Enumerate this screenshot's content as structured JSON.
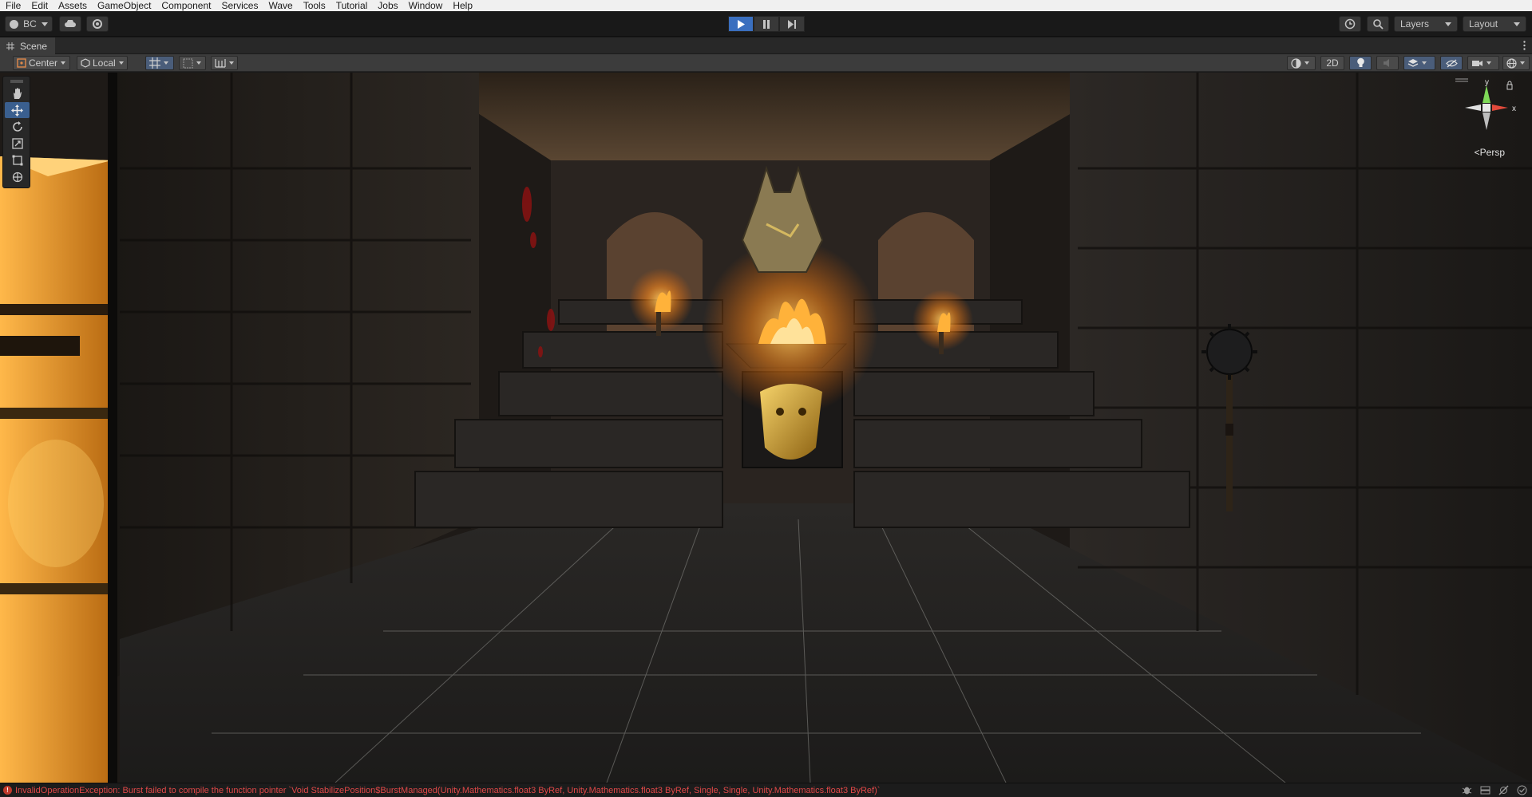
{
  "menubar": {
    "items": [
      "File",
      "Edit",
      "Assets",
      "GameObject",
      "Component",
      "Services",
      "Wave",
      "Tools",
      "Tutorial",
      "Jobs",
      "Window",
      "Help"
    ]
  },
  "toolbar": {
    "account_label": "BC",
    "layers_label": "Layers",
    "layout_label": "Layout",
    "play_state": "playing"
  },
  "scene": {
    "tab_label": "Scene",
    "pivot_label": "Center",
    "space_label": "Local",
    "mode_2d_label": "2D",
    "projection_label": "Persp",
    "axis_x_label": "x",
    "axis_y_label": "y",
    "active_tool": "move-tool"
  },
  "status": {
    "error_message": "InvalidOperationException: Burst failed to compile the function pointer `Void StabilizePosition$BurstManaged(Unity.Mathematics.float3 ByRef, Unity.Mathematics.float3 ByRef, Single, Single, Unity.Mathematics.float3 ByRef)`"
  },
  "colors": {
    "accent": "#3a6fbf",
    "error": "#e04848",
    "fire": "#ff9a1a",
    "gold": "#d4a52a"
  }
}
